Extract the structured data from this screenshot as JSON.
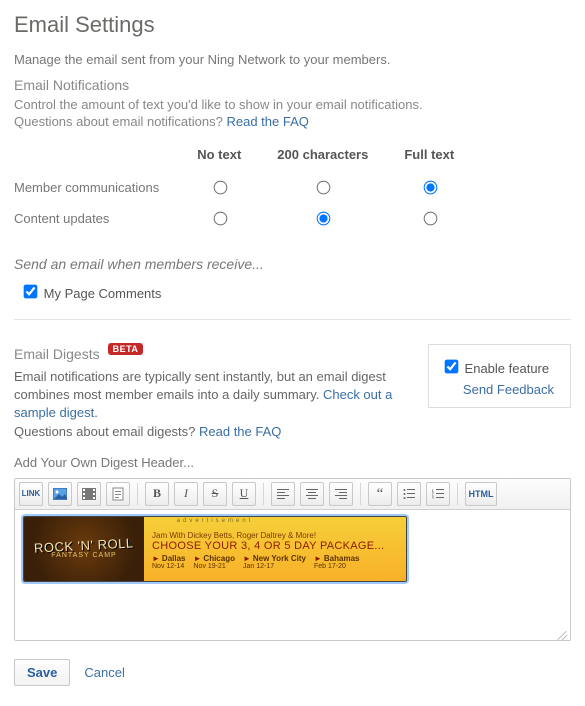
{
  "title": "Email Settings",
  "intro": "Manage the email sent from your Ning Network to your members.",
  "notifications": {
    "title": "Email Notifications",
    "desc": "Control the amount of text you'd like to show in your email notifications.",
    "faq_prefix": "Questions about email notifications? ",
    "faq_link": "Read the FAQ",
    "columns": [
      "No text",
      "200 characters",
      "Full text"
    ],
    "rows": [
      {
        "label": "Member communications",
        "selected": 2
      },
      {
        "label": "Content updates",
        "selected": 1
      }
    ],
    "trigger_line": "Send an email when members receive...",
    "checkbox_label": "My Page Comments",
    "checkbox_checked": true
  },
  "digests": {
    "title": "Email Digests",
    "beta": "BETA",
    "paragraph_a": "Email notifications are typically sent instantly, but an email digest combines most member emails into a daily summary. ",
    "sample_link": "Check out a sample digest.",
    "faq_prefix": "Questions about email digests? ",
    "faq_link": "Read the FAQ",
    "enable_label": "Enable feature",
    "enable_checked": true,
    "feedback_link": "Send Feedback",
    "add_header": "Add Your Own Digest Header..."
  },
  "banner": {
    "ad_label": "advertisement",
    "brand_top": "",
    "brand_main": "ROCK 'N' ROLL",
    "brand_sub": "FANTASY CAMP",
    "line1": "Jam With Dickey Betts, Roger Daltrey & More!",
    "line2": "CHOOSE YOUR 3, 4 OR 5 DAY PACKAGE...",
    "cities": [
      {
        "name": "Dallas",
        "dates": "Nov 12-14"
      },
      {
        "name": "Chicago",
        "dates": "Nov 19-21"
      },
      {
        "name": "New York City",
        "dates": "Jan 12-17"
      },
      {
        "name": "Bahamas",
        "dates": "Feb 17-20"
      }
    ]
  },
  "actions": {
    "save": "Save",
    "cancel": "Cancel"
  }
}
